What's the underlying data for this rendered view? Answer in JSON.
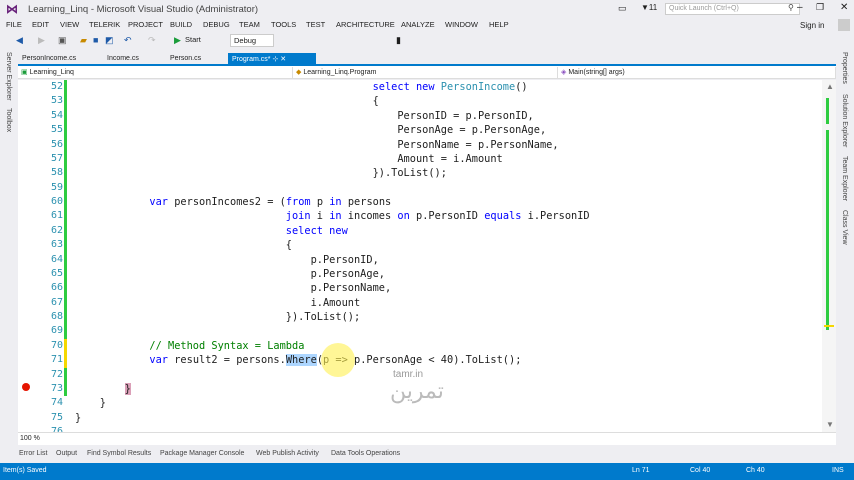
{
  "window": {
    "title": "Learning_Linq - Microsoft Visual Studio (Administrator)",
    "notifications": "11",
    "quick_launch_placeholder": "Quick Launch (Ctrl+Q)",
    "sign_in": "Sign in",
    "logo_text": "VS"
  },
  "menu": [
    "FILE",
    "EDIT",
    "VIEW",
    "TELERIK",
    "PROJECT",
    "BUILD",
    "DEBUG",
    "TEAM",
    "TOOLS",
    "TEST",
    "ARCHITECTURE",
    "ANALYZE",
    "WINDOW",
    "HELP"
  ],
  "toolbar": {
    "start": "Start",
    "config": "Debug"
  },
  "left_strip": [
    "Server Explorer",
    "Toolbox"
  ],
  "right_strip": [
    "Properties",
    "Solution Explorer",
    "Team Explorer",
    "Class View"
  ],
  "tabs": [
    {
      "label": "PersonIncome.cs"
    },
    {
      "label": "Income.cs"
    },
    {
      "label": "Person.cs"
    },
    {
      "label": "Program.cs*",
      "active": true
    }
  ],
  "navbar": {
    "project": "Learning_Linq",
    "class": "Learning_Linq.Program",
    "member": "Main(string[] args)"
  },
  "editor": {
    "zoom": "100 %",
    "breakpoint_line": 73,
    "lines": [
      {
        "n": "52",
        "chg": "g",
        "t": [
          [
            "",
            "                                                "
          ],
          [
            "kw",
            "select new "
          ],
          [
            "ty",
            "PersonIncome"
          ],
          [
            "",
            "()"
          ]
        ]
      },
      {
        "n": "53",
        "chg": "g",
        "t": [
          [
            "",
            "                                                {"
          ]
        ]
      },
      {
        "n": "54",
        "chg": "g",
        "t": [
          [
            "",
            "                                                    PersonID = p.PersonID,"
          ]
        ]
      },
      {
        "n": "55",
        "chg": "g",
        "t": [
          [
            "",
            "                                                    PersonAge = p.PersonAge,"
          ]
        ]
      },
      {
        "n": "56",
        "chg": "g",
        "t": [
          [
            "",
            "                                                    PersonName = p.PersonName,"
          ]
        ]
      },
      {
        "n": "57",
        "chg": "g",
        "t": [
          [
            "",
            "                                                    Amount = i.Amount"
          ]
        ]
      },
      {
        "n": "58",
        "chg": "g",
        "t": [
          [
            "",
            "                                                }).ToList();"
          ]
        ]
      },
      {
        "n": "59",
        "chg": "g",
        "t": [
          [
            "",
            ""
          ]
        ]
      },
      {
        "n": "60",
        "chg": "g",
        "t": [
          [
            "",
            "            "
          ],
          [
            "kw",
            "var"
          ],
          [
            "",
            " personIncomes2 = ("
          ],
          [
            "kw",
            "from"
          ],
          [
            "",
            " p "
          ],
          [
            "kw",
            "in"
          ],
          [
            "",
            " persons"
          ]
        ]
      },
      {
        "n": "61",
        "chg": "g",
        "t": [
          [
            "",
            "                                  "
          ],
          [
            "kw",
            "join"
          ],
          [
            "",
            " i "
          ],
          [
            "kw",
            "in"
          ],
          [
            "",
            " incomes "
          ],
          [
            "kw",
            "on"
          ],
          [
            "",
            " p.PersonID "
          ],
          [
            "kw",
            "equals"
          ],
          [
            "",
            " i.PersonID"
          ]
        ]
      },
      {
        "n": "62",
        "chg": "g",
        "t": [
          [
            "",
            "                                  "
          ],
          [
            "kw",
            "select new"
          ]
        ]
      },
      {
        "n": "63",
        "chg": "g",
        "t": [
          [
            "",
            "                                  {"
          ]
        ]
      },
      {
        "n": "64",
        "chg": "g",
        "t": [
          [
            "",
            "                                      p.PersonID,"
          ]
        ]
      },
      {
        "n": "65",
        "chg": "g",
        "t": [
          [
            "",
            "                                      p.PersonAge,"
          ]
        ]
      },
      {
        "n": "66",
        "chg": "g",
        "t": [
          [
            "",
            "                                      p.PersonName,"
          ]
        ]
      },
      {
        "n": "67",
        "chg": "g",
        "t": [
          [
            "",
            "                                      i.Amount"
          ]
        ]
      },
      {
        "n": "68",
        "chg": "g",
        "t": [
          [
            "",
            "                                  }).ToList();"
          ]
        ]
      },
      {
        "n": "69",
        "chg": "g",
        "t": [
          [
            "",
            ""
          ]
        ]
      },
      {
        "n": "70",
        "chg": "y",
        "t": [
          [
            "",
            "            "
          ],
          [
            "cm",
            "// Method Syntax = Lambda"
          ]
        ]
      },
      {
        "n": "71",
        "chg": "y",
        "t": [
          [
            "",
            "            "
          ],
          [
            "kw",
            "var"
          ],
          [
            "",
            " result2 = persons."
          ],
          [
            "sel",
            "Where"
          ],
          [
            "",
            "(p => p.PersonAge < 40).ToList();"
          ]
        ]
      },
      {
        "n": "72",
        "chg": "g",
        "t": [
          [
            "",
            ""
          ]
        ]
      },
      {
        "n": "73",
        "chg": "g",
        "t": [
          [
            "",
            "        "
          ],
          [
            "brace",
            "}"
          ]
        ]
      },
      {
        "n": "74",
        "chg": "",
        "t": [
          [
            "",
            "    }"
          ]
        ]
      },
      {
        "n": "75",
        "chg": "",
        "t": [
          [
            "",
            "}"
          ]
        ]
      },
      {
        "n": "76",
        "chg": "",
        "t": [
          [
            "",
            ""
          ]
        ]
      }
    ]
  },
  "watermark": {
    "latin": "tamr.in",
    "persian": "تمرین"
  },
  "bottom_tabs": [
    "Error List",
    "Output",
    "Find Symbol Results",
    "Package Manager Console",
    "Web Publish Activity",
    "Data Tools Operations"
  ],
  "status": {
    "message": "Item(s) Saved",
    "ln": "Ln 71",
    "col": "Col 40",
    "ch": "Ch 40",
    "mode": "INS"
  },
  "colors": {
    "accent": "#007acc",
    "keyword": "#0000ff",
    "type": "#2b91af",
    "comment": "#008000",
    "saved_change": "#2ecc40",
    "unsaved_change": "#f5d800"
  }
}
